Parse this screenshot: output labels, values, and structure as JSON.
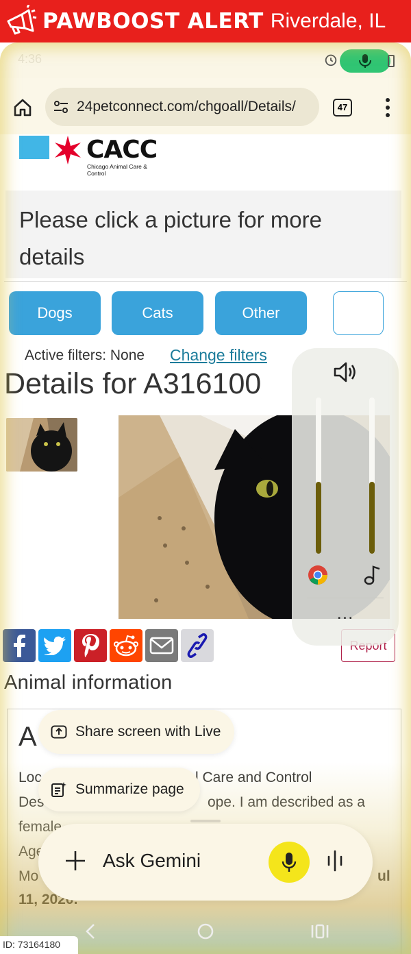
{
  "alert": {
    "title": "PAWBOOST ALERT",
    "location": "Riverdale, IL",
    "color": "#e8201c"
  },
  "status": {
    "time": "4:36"
  },
  "browser": {
    "url": "24petconnect.com/chgoall/Details/",
    "tab_count": "47"
  },
  "logo": {
    "brand": "CACC",
    "subtitle": "Chicago Animal Care & Control"
  },
  "page": {
    "click_note": "Please click a picture for more details",
    "filters": {
      "buttons": [
        "Dogs",
        "Cats",
        "Other"
      ],
      "active_label": "Active filters: None",
      "change_label": "Change filters"
    },
    "details_title": "Details for A316100",
    "report_label": "Report",
    "animal_info_title": "Animal information",
    "info": {
      "name_partial": "A",
      "location_partial": "Loc",
      "location_tail": "l Care and Control",
      "desc_partial": "Des",
      "desc_tail": "ope. I am described as a",
      "female_partial": "female",
      "age_partial": "Age",
      "more_partial": "Mo",
      "date_tail": "ul",
      "date_line": "11, 2020."
    }
  },
  "share_icons": [
    "facebook-icon",
    "twitter-icon",
    "pinterest-icon",
    "reddit-icon",
    "email-icon",
    "link-icon"
  ],
  "volume": {
    "media_level": 0.46,
    "system_level": 0.46,
    "more_label": "..."
  },
  "gemini": {
    "share_screen": "Share screen with Live",
    "summarize": "Summarize page",
    "ask": "Ask Gemini"
  },
  "id_tag": "ID: 73164180"
}
